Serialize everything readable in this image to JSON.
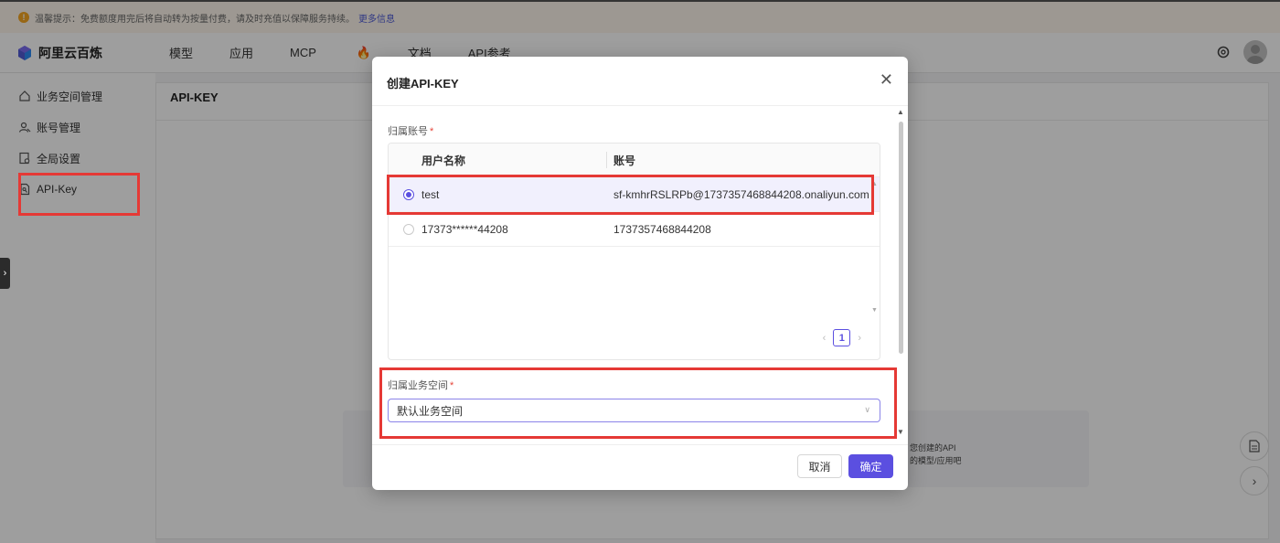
{
  "notice": {
    "text": "温馨提示：免费额度用完后将自动转为按量付费，请及时充值以保障服务持续。",
    "link": "更多信息"
  },
  "brand": {
    "name": "阿里云百炼"
  },
  "topnav": {
    "items": [
      "模型",
      "应用",
      "MCP",
      "文档",
      "API参考"
    ]
  },
  "sidebar": {
    "items": [
      {
        "label": "业务空间管理",
        "icon": "home-icon"
      },
      {
        "label": "账号管理",
        "icon": "users-icon"
      },
      {
        "label": "全局设置",
        "icon": "settings-doc-icon"
      },
      {
        "label": "API-Key",
        "icon": "key-doc-icon"
      }
    ]
  },
  "panel": {
    "title": "API-KEY",
    "empty_line1": "您创建的API",
    "empty_line2": "的模型/应用吧"
  },
  "dialog": {
    "title": "创建API-KEY",
    "account_label": "归属账号",
    "required_mark": "*",
    "table": {
      "headers": [
        "用户名称",
        "账号"
      ],
      "rows": [
        {
          "name": "test",
          "account": "sf-kmhrRSLRPb@1737357468844208.onaliyun.com",
          "selected": true
        },
        {
          "name": "17373******44208",
          "account": "1737357468844208",
          "selected": false
        }
      ]
    },
    "pager": {
      "prev": "‹",
      "current": "1",
      "next": "›"
    },
    "workspace_label": "归属业务空间",
    "workspace_value": "默认业务空间",
    "cancel_label": "取消",
    "ok_label": "确定"
  },
  "colors": {
    "accent": "#5b4fe0",
    "annotation": "#e53935",
    "selected_row": "#f1f0fd"
  }
}
